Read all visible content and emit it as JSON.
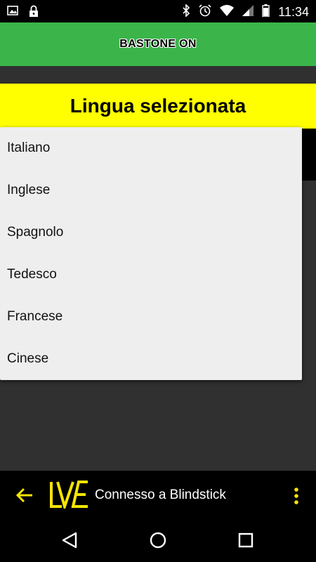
{
  "status_bar": {
    "time": "11:34",
    "icons": [
      "image-icon",
      "lock-icon",
      "bluetooth-icon",
      "alarm-icon",
      "wifi-icon",
      "signal-icon",
      "battery-icon"
    ]
  },
  "app_bar": {
    "title": "BASTONE ON",
    "color": "#3bb54a"
  },
  "banner": {
    "label": "Lingua selezionata",
    "color": "#ffff00"
  },
  "language_menu": {
    "options": [
      "Italiano",
      "Inglese",
      "Spagnolo",
      "Tedesco",
      "Francese",
      "Cinese"
    ]
  },
  "bottom_bar": {
    "status_text": "Connesso a Blindstick",
    "accent": "#f5e500"
  },
  "nav_bar": {
    "icons": [
      "back-triangle-icon",
      "home-circle-icon",
      "recents-square-icon"
    ]
  }
}
